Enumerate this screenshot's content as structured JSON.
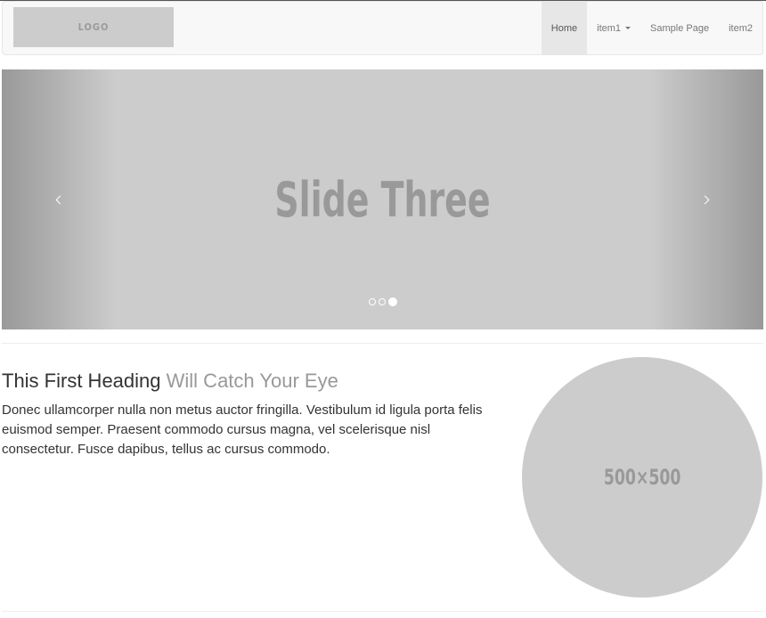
{
  "navbar": {
    "logo_text": "LOGO",
    "items": [
      {
        "label": "Home",
        "active": true
      },
      {
        "label": "item1",
        "dropdown": true
      },
      {
        "label": "Sample Page"
      },
      {
        "label": "item2"
      }
    ]
  },
  "carousel": {
    "slide_text": "Slide Three",
    "prev_icon": "chevron-left-icon",
    "next_icon": "chevron-right-icon",
    "indicators": 3,
    "active_indicator": 3
  },
  "feature": {
    "heading_main": "This First Heading",
    "heading_muted": "Will Catch Your Eye",
    "text": "Donec ullamcorper nulla non metus auctor fringilla. Vestibulum id ligula porta felis euismod semper. Praesent commodo cursus magna, vel scelerisque nisl consectetur. Fusce dapibus, tellus ac cursus commodo.",
    "image_text": "500×500"
  },
  "colors": {
    "placeholder": "#cccccc",
    "placeholder_text": "#999999",
    "navbar_bg": "#f8f8f8",
    "active_nav_bg": "#e7e7e7"
  }
}
